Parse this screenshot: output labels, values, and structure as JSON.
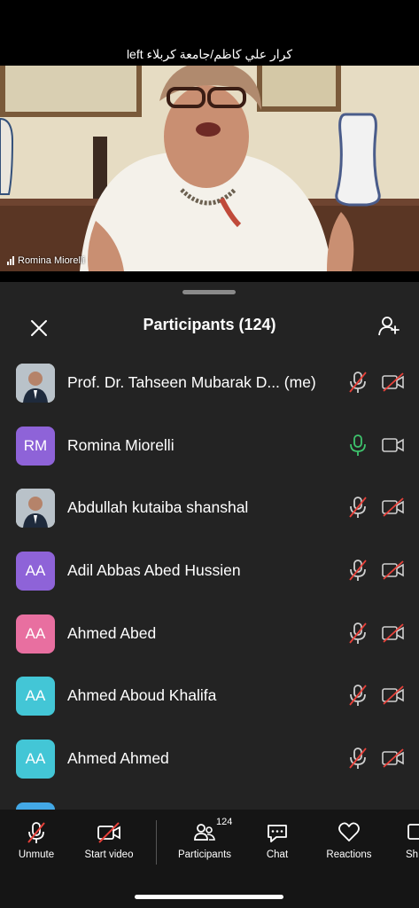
{
  "meeting": {
    "title": "كرار علي كاظم/جامعة كربلاء left"
  },
  "video": {
    "speaker_name": "Romina Miorelli"
  },
  "panel": {
    "title": "Participants (124)"
  },
  "participants": [
    {
      "name": "Prof. Dr. Tahseen Mubarak D...  (me)",
      "initials": "",
      "avatar_color": "#e8e8e8",
      "mic": "muted",
      "camera": "off"
    },
    {
      "name": "Romina Miorelli",
      "initials": "RM",
      "avatar_color": "#8e63d8",
      "mic": "on",
      "camera": "on"
    },
    {
      "name": "Abdullah kutaiba shanshal",
      "initials": "",
      "avatar_color": "#d9d9d9",
      "mic": "muted",
      "camera": "off"
    },
    {
      "name": "Adil Abbas Abed Hussien",
      "initials": "AA",
      "avatar_color": "#8e63d8",
      "mic": "muted",
      "camera": "off"
    },
    {
      "name": "Ahmed Abed",
      "initials": "AA",
      "avatar_color": "#e86fa0",
      "mic": "muted",
      "camera": "off"
    },
    {
      "name": "Ahmed Aboud Khalifa",
      "initials": "AA",
      "avatar_color": "#43c6d6",
      "mic": "muted",
      "camera": "off"
    },
    {
      "name": "Ahmed Ahmed",
      "initials": "AA",
      "avatar_color": "#43c6d6",
      "mic": "muted",
      "camera": "off"
    }
  ],
  "toolbar": {
    "unmute_label": "Unmute",
    "start_video_label": "Start video",
    "participants_label": "Participants",
    "participants_count": "124",
    "chat_label": "Chat",
    "reactions_label": "Reactions",
    "share_label": "Sh"
  },
  "colors": {
    "muted_red": "#e8413a",
    "mic_on_green": "#3ec46d",
    "sheet_bg": "#232323"
  }
}
